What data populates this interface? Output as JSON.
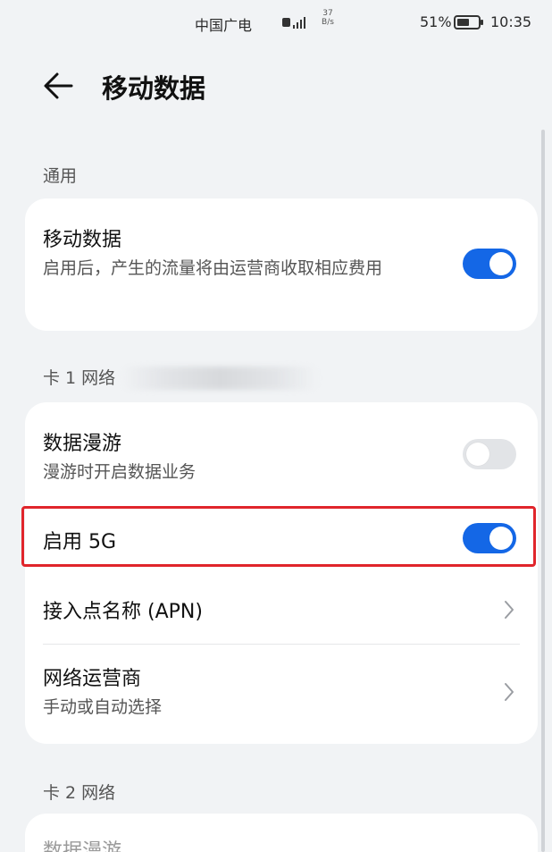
{
  "status_bar": {
    "carrier": "中国广电",
    "speed_value": "37",
    "speed_unit": "B/s",
    "battery_percent": "51%",
    "time": "10:35"
  },
  "app_bar": {
    "title": "移动数据",
    "back_icon": "arrow-left-icon"
  },
  "sections": {
    "general": {
      "label": "通用",
      "mobile_data": {
        "title": "移动数据",
        "subtitle": "启用后，产生的流量将由运营商收取相应费用",
        "enabled": true
      }
    },
    "sim1": {
      "label": "卡 1 网络",
      "data_roaming": {
        "title": "数据漫游",
        "subtitle": "漫游时开启数据业务",
        "enabled": false
      },
      "enable_5g": {
        "title": "启用 5G",
        "enabled": true
      },
      "apn": {
        "title": "接入点名称 (APN)"
      },
      "network_operator": {
        "title": "网络运营商",
        "subtitle": "手动或自动选择"
      }
    },
    "sim2": {
      "label": "卡 2 网络",
      "data_roaming_peek": "数据漫游"
    }
  },
  "colors": {
    "accent": "#1467e6",
    "toggle_off": "#e2e4e7",
    "highlight": "#e0252b",
    "background": "#f1f3f5",
    "card": "#ffffff"
  }
}
